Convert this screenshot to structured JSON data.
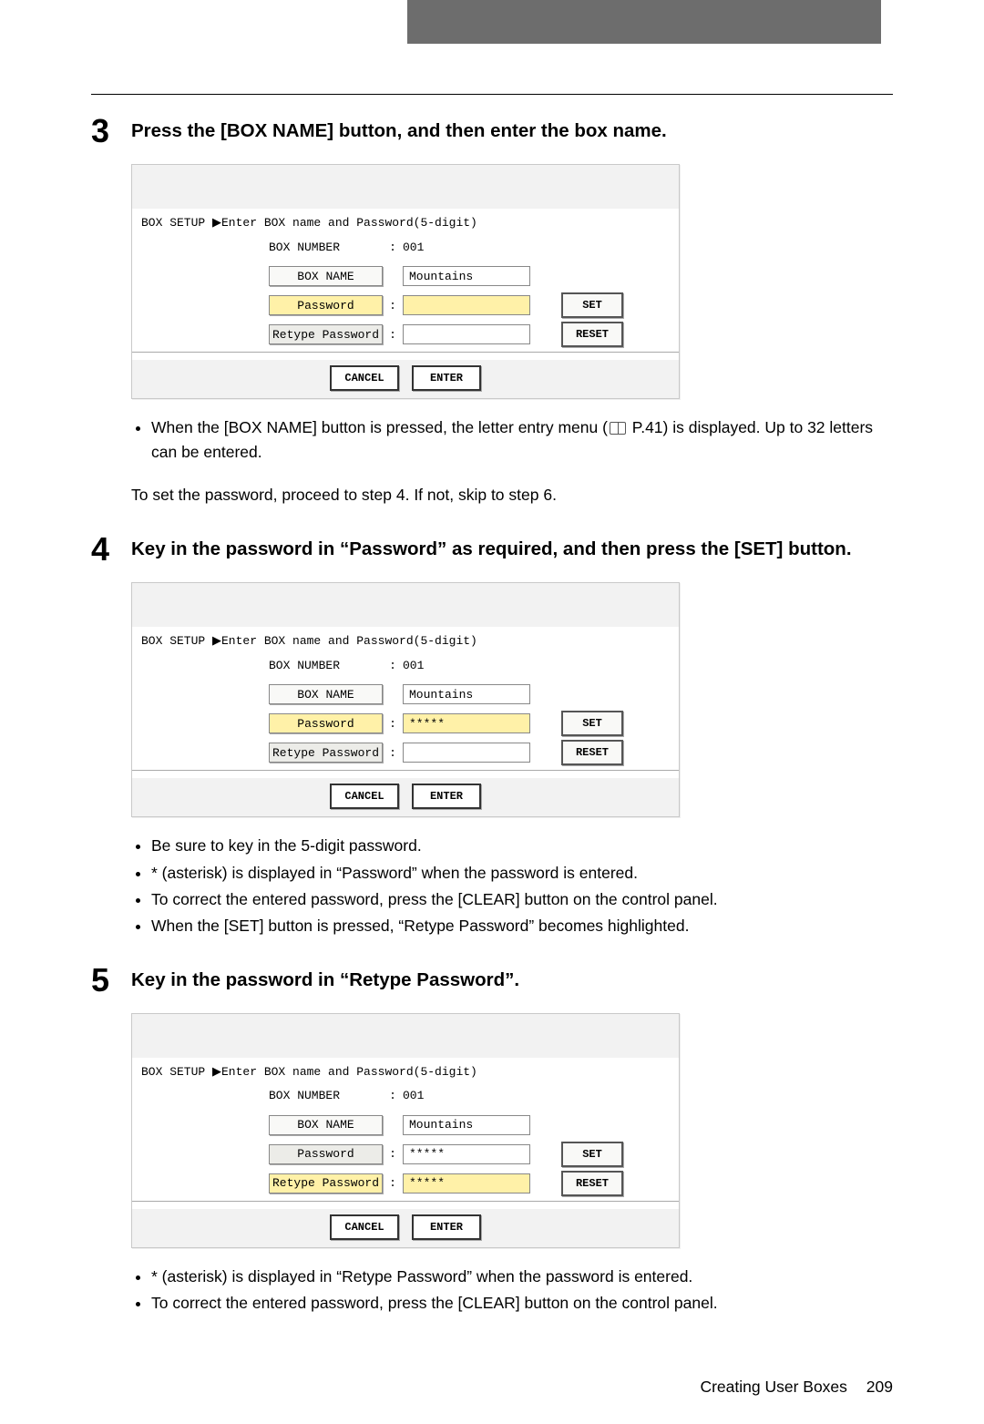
{
  "header_band": "",
  "step3": {
    "num": "3",
    "title": "Press the [BOX NAME] button, and then enter the box name.",
    "screen": {
      "hint": "BOX SETUP ▶Enter BOX name and Password(5-digit)",
      "box_number_label": "BOX NUMBER",
      "box_number_value": "001",
      "box_name_label": "BOX NAME",
      "box_name_value": "Mountains",
      "password_label": "Password",
      "password_value": "",
      "retype_label": "Retype Password",
      "retype_value": "",
      "set_label": "SET",
      "reset_label": "RESET",
      "cancel_label": "CANCEL",
      "enter_label": "ENTER"
    },
    "notes": {
      "n1_a": "When the [BOX NAME] button is pressed, the letter entry menu (",
      "n1_b": " P.41) is displayed. Up to 32 letters can be entered.",
      "para": "To set the password, proceed to step 4. If not, skip to step 6."
    }
  },
  "step4": {
    "num": "4",
    "title": "Key in the password in “Password” as required, and then press the [SET] button.",
    "screen": {
      "hint": "BOX SETUP ▶Enter BOX name and Password(5-digit)",
      "box_number_label": "BOX NUMBER",
      "box_number_value": "001",
      "box_name_label": "BOX NAME",
      "box_name_value": "Mountains",
      "password_label": "Password",
      "password_value": "*****",
      "retype_label": "Retype Password",
      "retype_value": "",
      "set_label": "SET",
      "reset_label": "RESET",
      "cancel_label": "CANCEL",
      "enter_label": "ENTER"
    },
    "notes": {
      "n1": "Be sure to key in the 5-digit password.",
      "n2": "* (asterisk) is displayed in “Password” when the password is entered.",
      "n3": "To correct the entered password, press the [CLEAR] button on the control panel.",
      "n4": "When the [SET] button is pressed, “Retype Password” becomes highlighted."
    }
  },
  "step5": {
    "num": "5",
    "title": "Key in the password in “Retype Password”.",
    "screen": {
      "hint": "BOX SETUP ▶Enter BOX name and Password(5-digit)",
      "box_number_label": "BOX NUMBER",
      "box_number_value": "001",
      "box_name_label": "BOX NAME",
      "box_name_value": "Mountains",
      "password_label": "Password",
      "password_value": "*****",
      "retype_label": "Retype Password",
      "retype_value": "*****",
      "set_label": "SET",
      "reset_label": "RESET",
      "cancel_label": "CANCEL",
      "enter_label": "ENTER"
    },
    "notes": {
      "n1": " * (asterisk) is displayed in “Retype Password” when the password is entered.",
      "n2": "To correct the entered password, press the [CLEAR] button on the control panel."
    }
  },
  "footer": {
    "section": "Creating User Boxes",
    "page": "209"
  }
}
